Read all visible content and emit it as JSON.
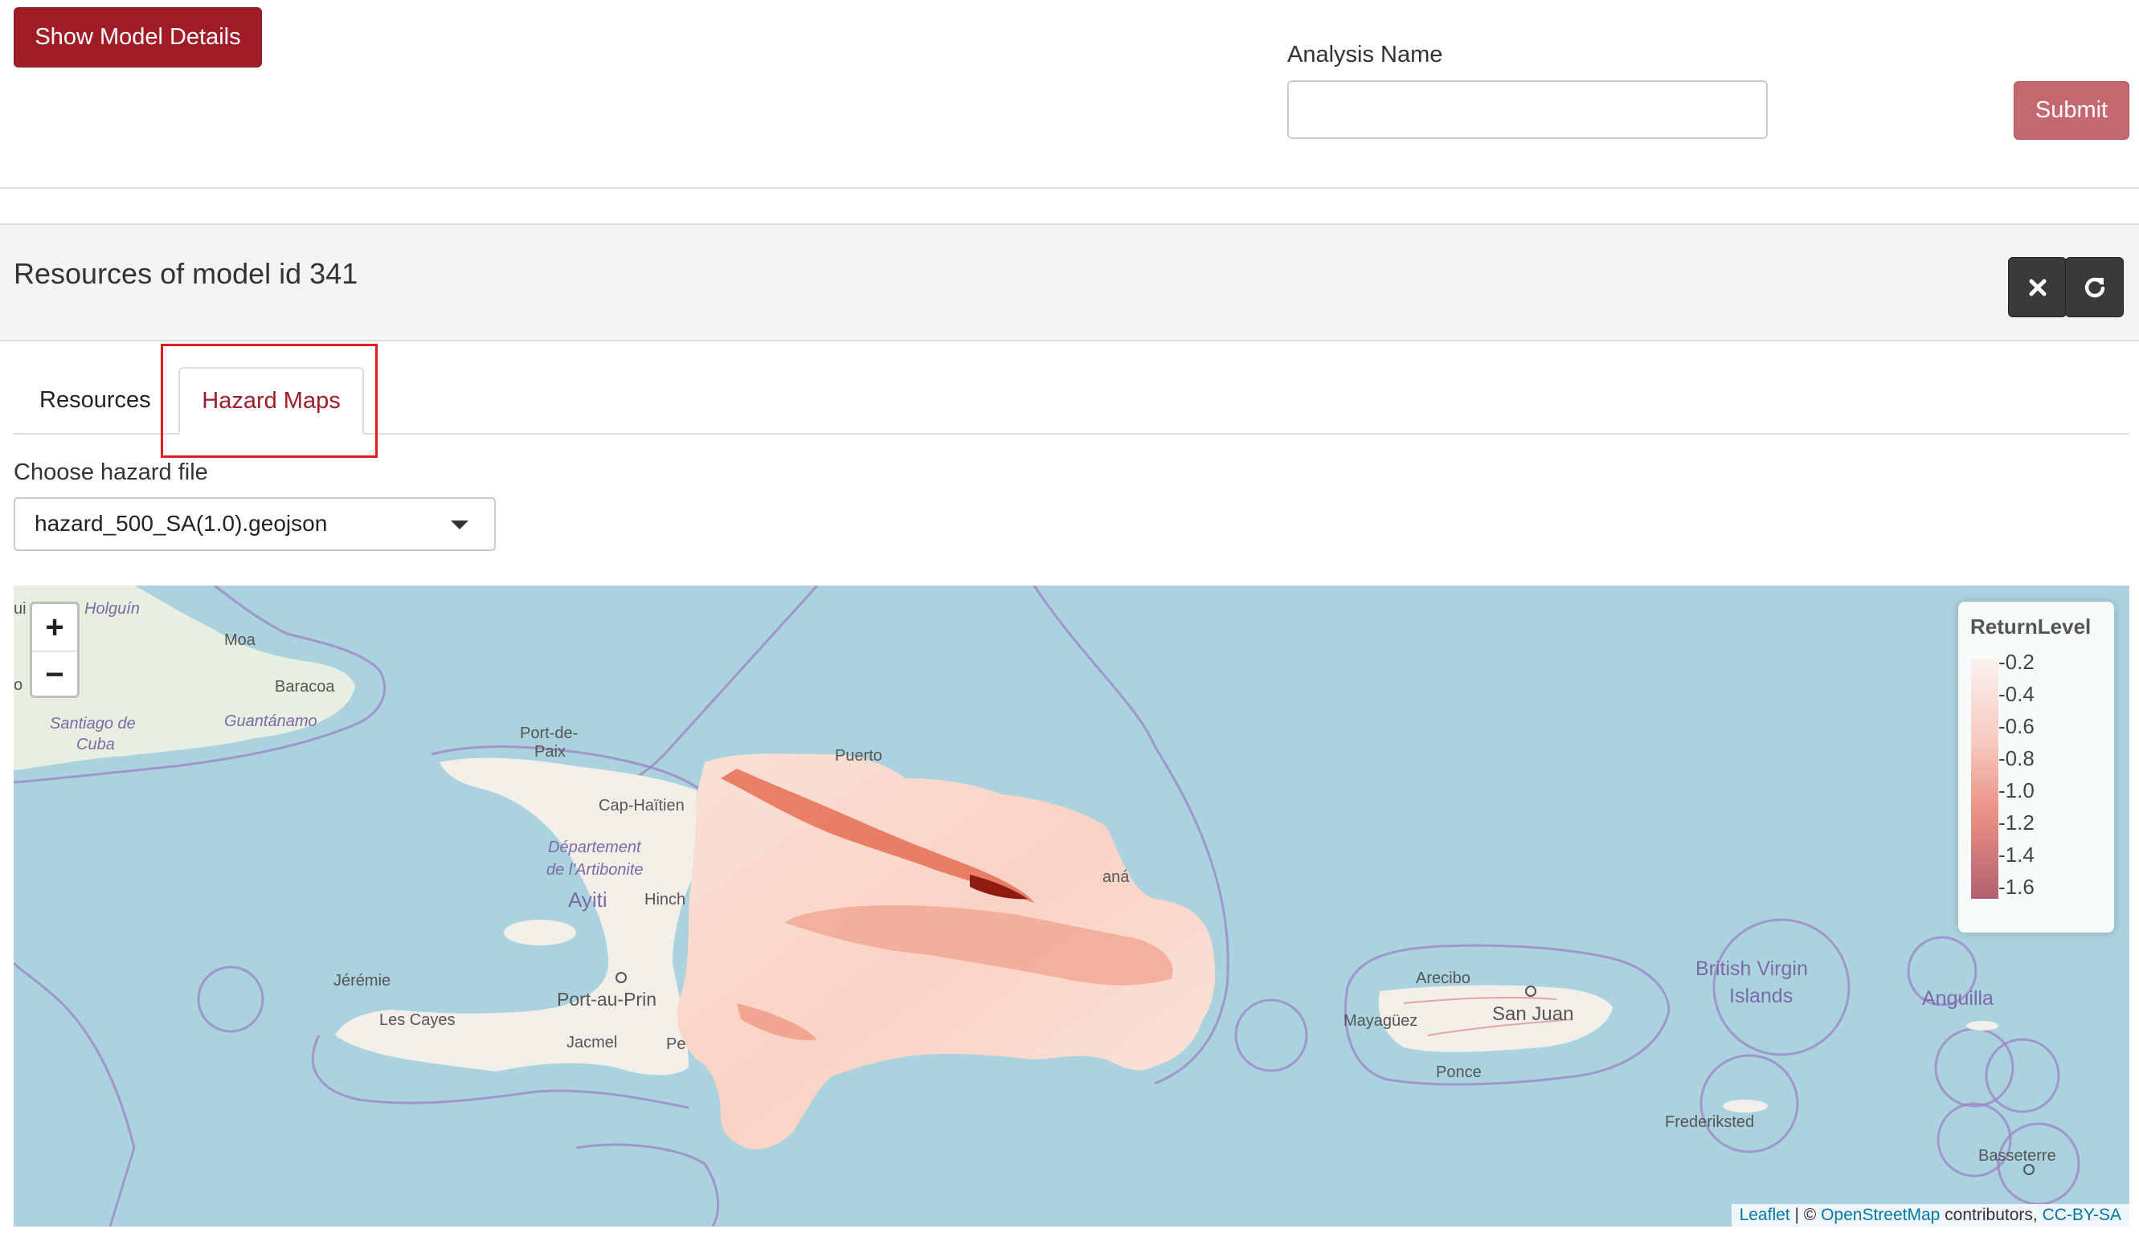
{
  "top": {
    "show_details_label": "Show Model Details",
    "analysis_label": "Analysis Name",
    "analysis_value": "",
    "submit_label": "Submit"
  },
  "panel": {
    "title": "Resources of model id 341",
    "close_icon": "close-icon",
    "refresh_icon": "refresh-icon"
  },
  "tabs": [
    {
      "label": "Resources",
      "active": false
    },
    {
      "label": "Hazard Maps",
      "active": true
    }
  ],
  "hazard": {
    "choose_label": "Choose hazard file",
    "selected_file": "hazard_500_SA(1.0).geojson"
  },
  "map": {
    "zoom_in": "+",
    "zoom_out": "−",
    "legend_title": "ReturnLevel",
    "legend_ticks": [
      "0.2",
      "0.4",
      "0.6",
      "0.8",
      "1.0",
      "1.2",
      "1.4",
      "1.6"
    ],
    "legend_colors": [
      "#fbf2ef",
      "#b1616f"
    ],
    "attribution": {
      "leaflet": "Leaflet",
      "sep": " | © ",
      "osm": "OpenStreetMap",
      "contrib": " contributors, ",
      "license": "CC-BY-SA"
    },
    "places": {
      "holguin": "Holguín",
      "moa": "Moa",
      "baracoa": "Baracoa",
      "santiago": "Santiago de",
      "cuba": "Cuba",
      "guantanamo": "Guantánamo",
      "port_de": "Port-de-",
      "paix": "Paix",
      "cap_haitien": "Cap-Haïtien",
      "departement": "Département",
      "artibonite": "de l'Artibonite",
      "ayiti": "Ayiti",
      "hinche": "Hinch",
      "jeremie": "Jérémie",
      "les_cayes": "Les Cayes",
      "port_au_prince": "Port-au-Prin",
      "jacmel": "Jacmel",
      "pe": "Pe",
      "puerto": "Puerto",
      "samana": "aná",
      "arecibo": "Arecibo",
      "mayaguez": "Mayagüez",
      "san_juan": "San Juan",
      "ponce": "Ponce",
      "bvi1": "British Virgin",
      "bvi2": "Islands",
      "anguilla": "Anguilla",
      "frederiksted": "Frederiksted",
      "basseterre": "Basseterre",
      "ui": "ui",
      "o": "o"
    }
  }
}
